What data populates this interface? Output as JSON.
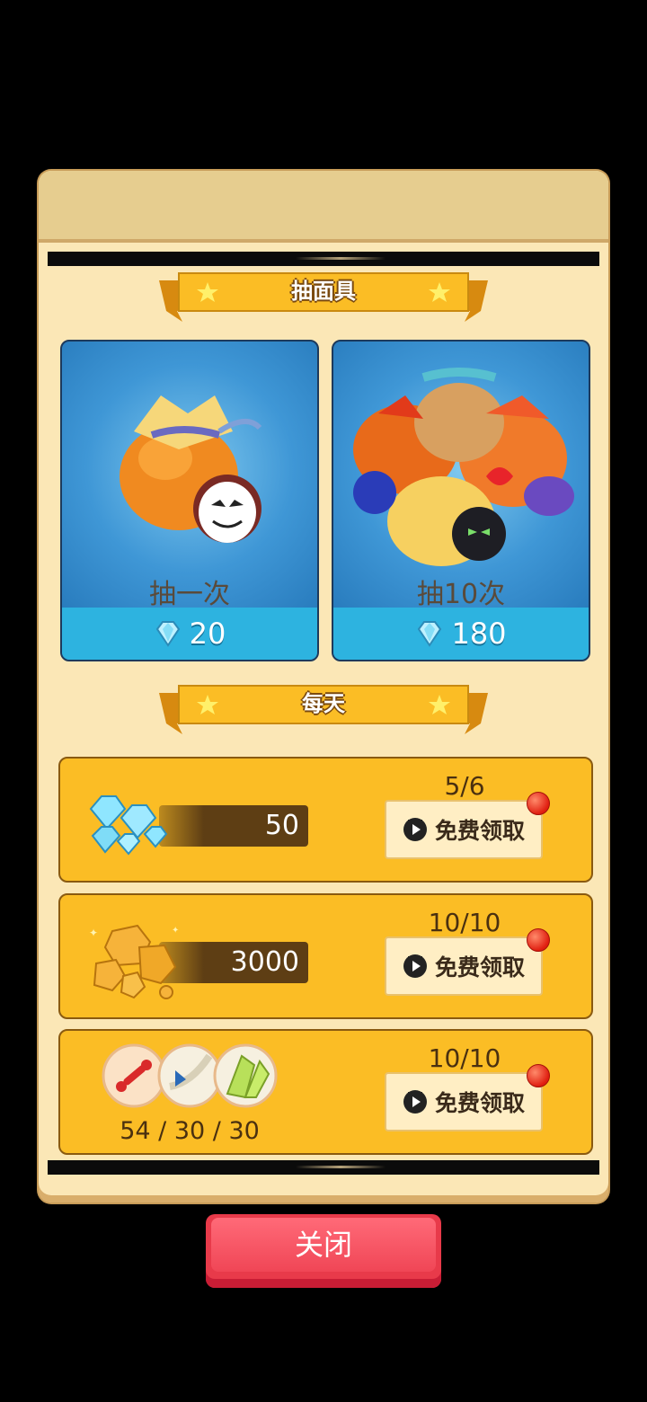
{
  "sections": {
    "draw_title": "抽面具",
    "daily_title": "每天"
  },
  "draw_cards": [
    {
      "label": "抽一次",
      "price": "20"
    },
    {
      "label": "抽10次",
      "price": "180"
    }
  ],
  "daily_rows": [
    {
      "reward": "50",
      "count": "5/6",
      "button": "免费领取"
    },
    {
      "reward": "3000",
      "count": "10/10",
      "button": "免费领取"
    },
    {
      "reward": "54 / 30 / 30",
      "count": "10/10",
      "button": "免费领取"
    }
  ],
  "close_label": "关闭",
  "colors": {
    "panel": "#fbe7b6",
    "ribbon": "#fbbd25",
    "row_bg": "#fbbd25",
    "card_blue": "#3f97d6",
    "price_bar": "#2db3e0",
    "close_red": "#e83a4a",
    "notify_red": "#e01e10"
  },
  "icons": {
    "currency": "diamond-icon",
    "claim": "video-play-icon",
    "rewards": [
      "diamond-pile-icon",
      "gold-ore-icon",
      "bone-icon",
      "claw-icon",
      "wing-icon"
    ]
  }
}
